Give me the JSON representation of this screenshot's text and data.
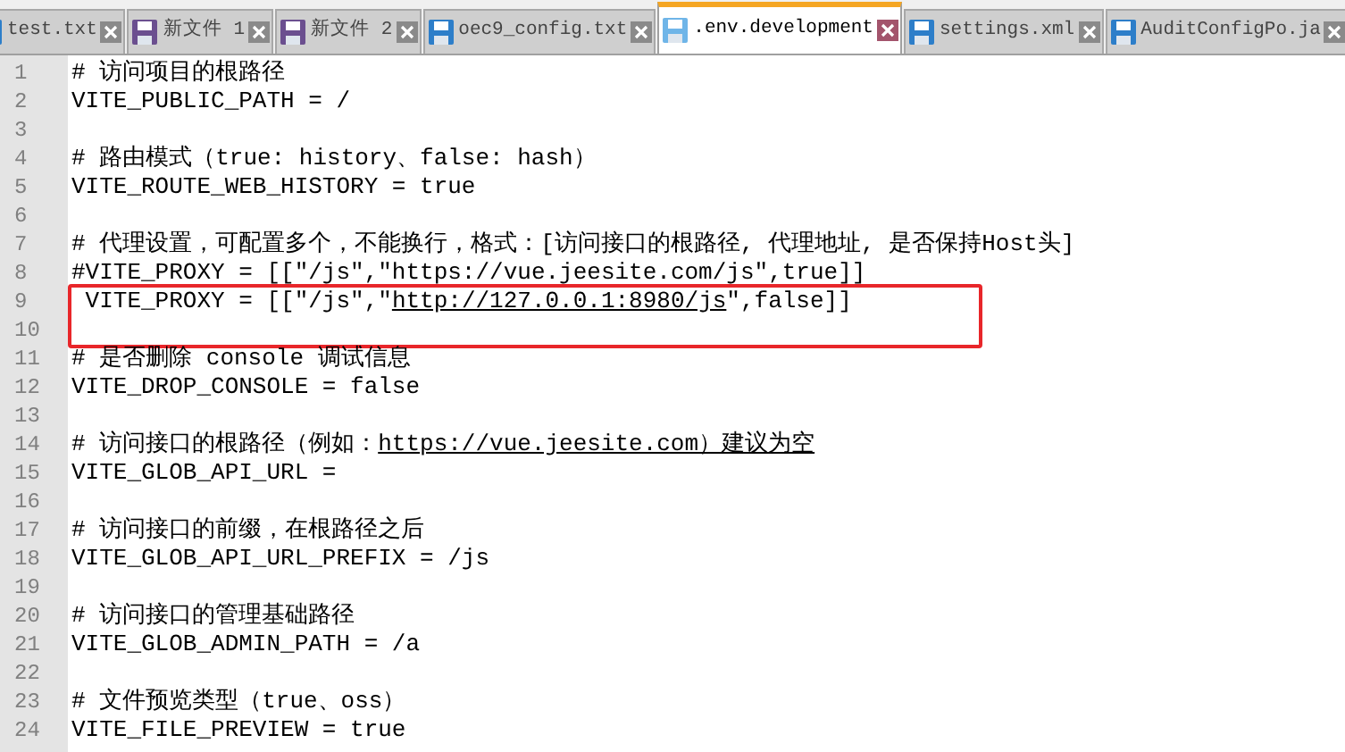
{
  "tabs": [
    {
      "label": "test.txt",
      "selected": false,
      "modified": false
    },
    {
      "label": "新文件 1",
      "selected": false,
      "modified": true
    },
    {
      "label": "新文件 2",
      "selected": false,
      "modified": true
    },
    {
      "label": "oec9_config.txt",
      "selected": false,
      "modified": false
    },
    {
      "label": ".env.development",
      "selected": true,
      "modified": false
    },
    {
      "label": "settings.xml",
      "selected": false,
      "modified": false
    },
    {
      "label": "AuditConfigPo.ja",
      "selected": false,
      "modified": false
    }
  ],
  "lines": [
    {
      "number": "1",
      "boxed": false,
      "segments": [
        {
          "text": "# 访问项目的根路径",
          "link": false
        }
      ]
    },
    {
      "number": "2",
      "boxed": false,
      "segments": [
        {
          "text": "VITE_PUBLIC_PATH = /",
          "link": false
        }
      ]
    },
    {
      "number": "3",
      "boxed": false
    },
    {
      "number": "4",
      "boxed": false,
      "segments": [
        {
          "text": "# 路由模式（true: history、false: hash）",
          "link": false
        }
      ]
    },
    {
      "number": "5",
      "boxed": false,
      "segments": [
        {
          "text": "VITE_ROUTE_WEB_HISTORY = true",
          "link": false
        }
      ]
    },
    {
      "number": "6",
      "boxed": false
    },
    {
      "number": "7",
      "boxed": false,
      "segments": [
        {
          "text": "# 代理设置，可配置多个，不能换行，格式：[访问接口的根路径, 代理地址, 是否保持Host头]",
          "link": false
        }
      ]
    },
    {
      "number": "8",
      "boxed": false,
      "segments": [
        {
          "text": "#VITE_PROXY = [[\"/js\",\"https://vue.jeesite.com/js\",true]]",
          "link": false
        }
      ]
    },
    {
      "number": "9",
      "boxed": true,
      "segments": [
        {
          "text": " VITE_PROXY = [[\"/js\",\"",
          "link": false
        },
        {
          "text": "http://127.0.0.1:8980/js",
          "link": true
        },
        {
          "text": "\",false]]",
          "link": false
        }
      ]
    },
    {
      "number": "10",
      "boxed": true
    },
    {
      "number": "11",
      "boxed": false,
      "segments": [
        {
          "text": "# 是否删除 console 调试信息",
          "link": false
        }
      ]
    },
    {
      "number": "12",
      "boxed": false,
      "segments": [
        {
          "text": "VITE_DROP_CONSOLE = false",
          "link": false
        }
      ]
    },
    {
      "number": "13",
      "boxed": false
    },
    {
      "number": "14",
      "boxed": false,
      "segments": [
        {
          "text": "# 访问接口的根路径（例如：",
          "link": false
        },
        {
          "text": "https://vue.jeesite.com）建议为空",
          "link": true
        }
      ]
    },
    {
      "number": "15",
      "boxed": false,
      "segments": [
        {
          "text": "VITE_GLOB_API_URL =",
          "link": false
        }
      ]
    },
    {
      "number": "16",
      "boxed": false
    },
    {
      "number": "17",
      "boxed": false,
      "segments": [
        {
          "text": "# 访问接口的前缀，在根路径之后",
          "link": false
        }
      ]
    },
    {
      "number": "18",
      "boxed": false,
      "segments": [
        {
          "text": "VITE_GLOB_API_URL_PREFIX = /js",
          "link": false
        }
      ]
    },
    {
      "number": "19",
      "boxed": false
    },
    {
      "number": "20",
      "boxed": false,
      "segments": [
        {
          "text": "# 访问接口的管理基础路径",
          "link": false
        }
      ]
    },
    {
      "number": "21",
      "boxed": false,
      "segments": [
        {
          "text": "VITE_GLOB_ADMIN_PATH = /a",
          "link": false
        }
      ]
    },
    {
      "number": "22",
      "boxed": false
    },
    {
      "number": "23",
      "boxed": false,
      "segments": [
        {
          "text": "# 文件预览类型（true、oss）",
          "link": false
        }
      ]
    },
    {
      "number": "24",
      "boxed": false,
      "segments": [
        {
          "text": "VITE_FILE_PREVIEW = true",
          "link": false
        }
      ]
    }
  ]
}
